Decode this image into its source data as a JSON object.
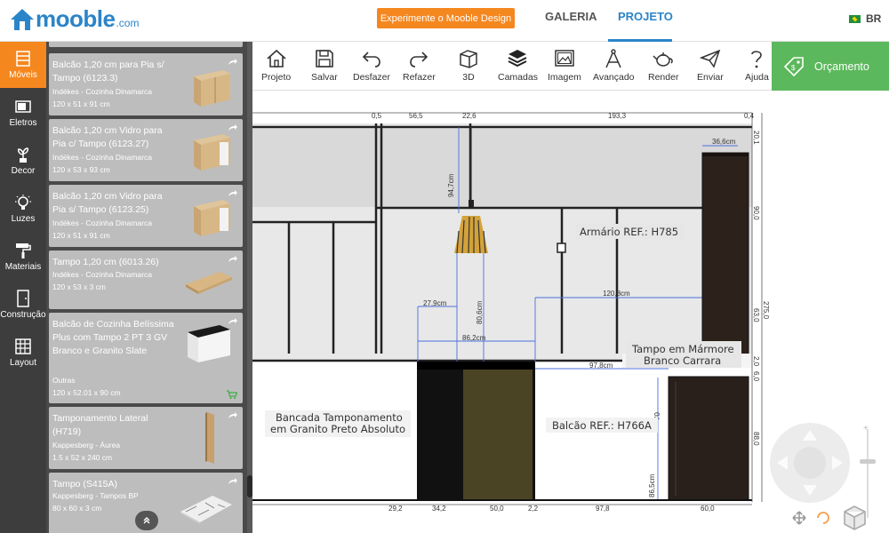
{
  "header": {
    "logo": "mooble",
    "logo_suffix": ".com",
    "promo_button": "Experimente o Mooble Design",
    "tabs": [
      {
        "label": "GALERIA"
      },
      {
        "label": "PROJETO"
      }
    ],
    "active_tab": "PROJETO",
    "language": "BR"
  },
  "nav": {
    "items": [
      {
        "label": "Móveis",
        "icon": "furniture-icon"
      },
      {
        "label": "Eletros",
        "icon": "appliance-icon"
      },
      {
        "label": "Decor",
        "icon": "plant-icon"
      },
      {
        "label": "Luzes",
        "icon": "lightbulb-icon"
      },
      {
        "label": "Materiais",
        "icon": "paint-roller-icon"
      },
      {
        "label": "Construção",
        "icon": "door-icon"
      },
      {
        "label": "Layout",
        "icon": "grid-icon"
      }
    ],
    "active": "Móveis"
  },
  "catalog": {
    "items": [
      {
        "title": "Balcão 1,20 cm para Pia s/ Tampo (6123.3)",
        "brand": "Indékes - Cozinha Dinamarca",
        "dims": "120 x 51 x 91 cm"
      },
      {
        "title": "Balcão 1,20 cm Vidro para Pia c/ Tampo (6123.27)",
        "brand": "Indékes - Cozinha Dinamarca",
        "dims": "120 x 53 x 93 cm"
      },
      {
        "title": "Balcão 1,20 cm Vidro para Pia s/ Tampo (6123.25)",
        "brand": "Indékes - Cozinha Dinamarca",
        "dims": "120 x 51 x 91 cm"
      },
      {
        "title": "Tampo 1,20 cm (6013.26)",
        "brand": "Indékes - Cozinha Dinamarca",
        "dims": "120 x 53 x 3 cm"
      },
      {
        "title": "Balcão de Cozinha Belíssima Plus com Tampo 2 PT 3 GV Branco e Granito Slate",
        "brand": "Outras",
        "dims": "120 x 52.01 x 90 cm"
      },
      {
        "title": "Tamponamento Lateral (H719)",
        "brand": "Kappesberg - Áurea",
        "dims": "1.5 x 52 x 240 cm"
      },
      {
        "title": "Tampo (S415A)",
        "brand": "Kappesberg - Tampos BP",
        "dims": "80 x 60 x 3 cm"
      }
    ]
  },
  "toolbar": {
    "tools": [
      {
        "label": "Projeto",
        "icon": "home-icon"
      },
      {
        "label": "Salvar",
        "icon": "save-icon"
      },
      {
        "label": "Desfazer",
        "icon": "undo-icon"
      },
      {
        "label": "Refazer",
        "icon": "redo-icon"
      },
      {
        "label": "3D",
        "icon": "cube-icon"
      },
      {
        "label": "Camadas",
        "icon": "layers-icon"
      },
      {
        "label": "Imagem",
        "icon": "image-icon"
      },
      {
        "label": "Avançado",
        "icon": "compass-icon"
      },
      {
        "label": "Render",
        "icon": "teapot-icon"
      },
      {
        "label": "Enviar",
        "icon": "send-icon"
      },
      {
        "label": "Ajuda",
        "icon": "help-icon"
      }
    ],
    "budget_label": "Orçamento"
  },
  "drawing": {
    "top_dims": [
      "0,5",
      "56,5",
      "22,6",
      "193,3",
      "0,4"
    ],
    "bottom_dims": [
      "29,2",
      "34,2",
      "50,0",
      "2,2",
      "97,8",
      "60,0"
    ],
    "right_dims": [
      "20,1",
      "90,0",
      "63,0",
      "275,0",
      "2,0",
      "6,0",
      "88,0"
    ],
    "inner_dims": [
      "94,7cm",
      "36,6cm",
      "27,9cm",
      "80,6cm",
      "86,2cm",
      "120,8cm",
      "97,8cm",
      "70",
      "86,5cm"
    ],
    "labels": {
      "armario": "Armário REF.: H785",
      "tampo": "Tampo em Mármore\nBranco Carrara",
      "bancada": "Bancada Tamponamento\nem Granito Preto Absoluto",
      "balcao": "Balcão REF.: H766A"
    }
  }
}
